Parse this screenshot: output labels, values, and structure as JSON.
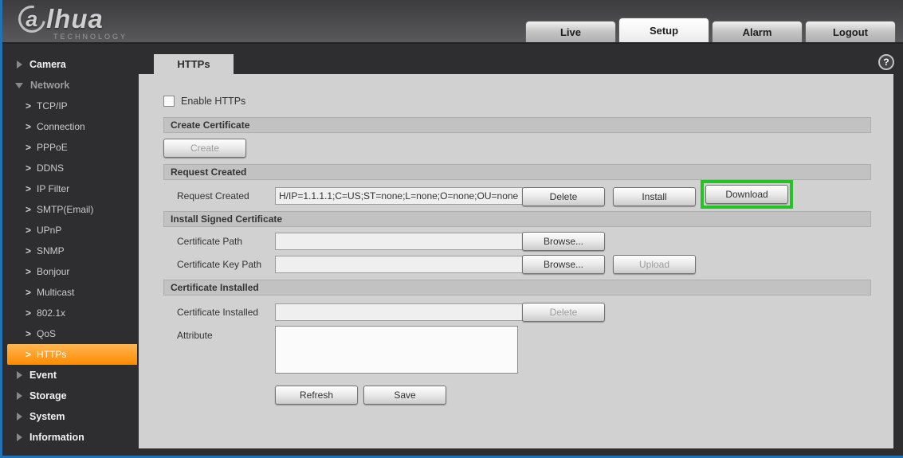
{
  "header": {
    "logo_a": "a",
    "logo_rest": "lhua",
    "logo_sub": "TECHNOLOGY",
    "tabs": [
      {
        "label": "Live"
      },
      {
        "label": "Setup"
      },
      {
        "label": "Alarm"
      },
      {
        "label": "Logout"
      }
    ]
  },
  "sidebar": {
    "items": [
      {
        "label": "Camera"
      },
      {
        "label": "Network"
      },
      {
        "label": "TCP/IP"
      },
      {
        "label": "Connection"
      },
      {
        "label": "PPPoE"
      },
      {
        "label": "DDNS"
      },
      {
        "label": "IP Filter"
      },
      {
        "label": "SMTP(Email)"
      },
      {
        "label": "UPnP"
      },
      {
        "label": "SNMP"
      },
      {
        "label": "Bonjour"
      },
      {
        "label": "Multicast"
      },
      {
        "label": "802.1x"
      },
      {
        "label": "QoS"
      },
      {
        "label": "HTTPs"
      },
      {
        "label": "Event"
      },
      {
        "label": "Storage"
      },
      {
        "label": "System"
      },
      {
        "label": "Information"
      }
    ]
  },
  "main": {
    "page_tab": "HTTPs",
    "help_icon": "?",
    "enable_label": "Enable HTTPs",
    "create_certificate": {
      "header": "Create Certificate",
      "create_button": "Create"
    },
    "request_created": {
      "header": "Request Created",
      "label": "Request Created",
      "value": "H/IP=1.1.1.1;C=US;ST=none;L=none;O=none;OU=none",
      "delete_button": "Delete",
      "install_button": "Install",
      "download_button": "Download",
      "highlight_color": "#24c224"
    },
    "install_signed": {
      "header": "Install Signed Certificate",
      "cert_path_label": "Certificate Path",
      "cert_key_path_label": "Certificate Key Path",
      "browse_button": "Browse...",
      "upload_button": "Upload"
    },
    "certificate_installed": {
      "header": "Certificate Installed",
      "label": "Certificate Installed",
      "delete_button": "Delete",
      "attribute_label": "Attribute"
    },
    "footer": {
      "refresh_button": "Refresh",
      "save_button": "Save"
    }
  }
}
